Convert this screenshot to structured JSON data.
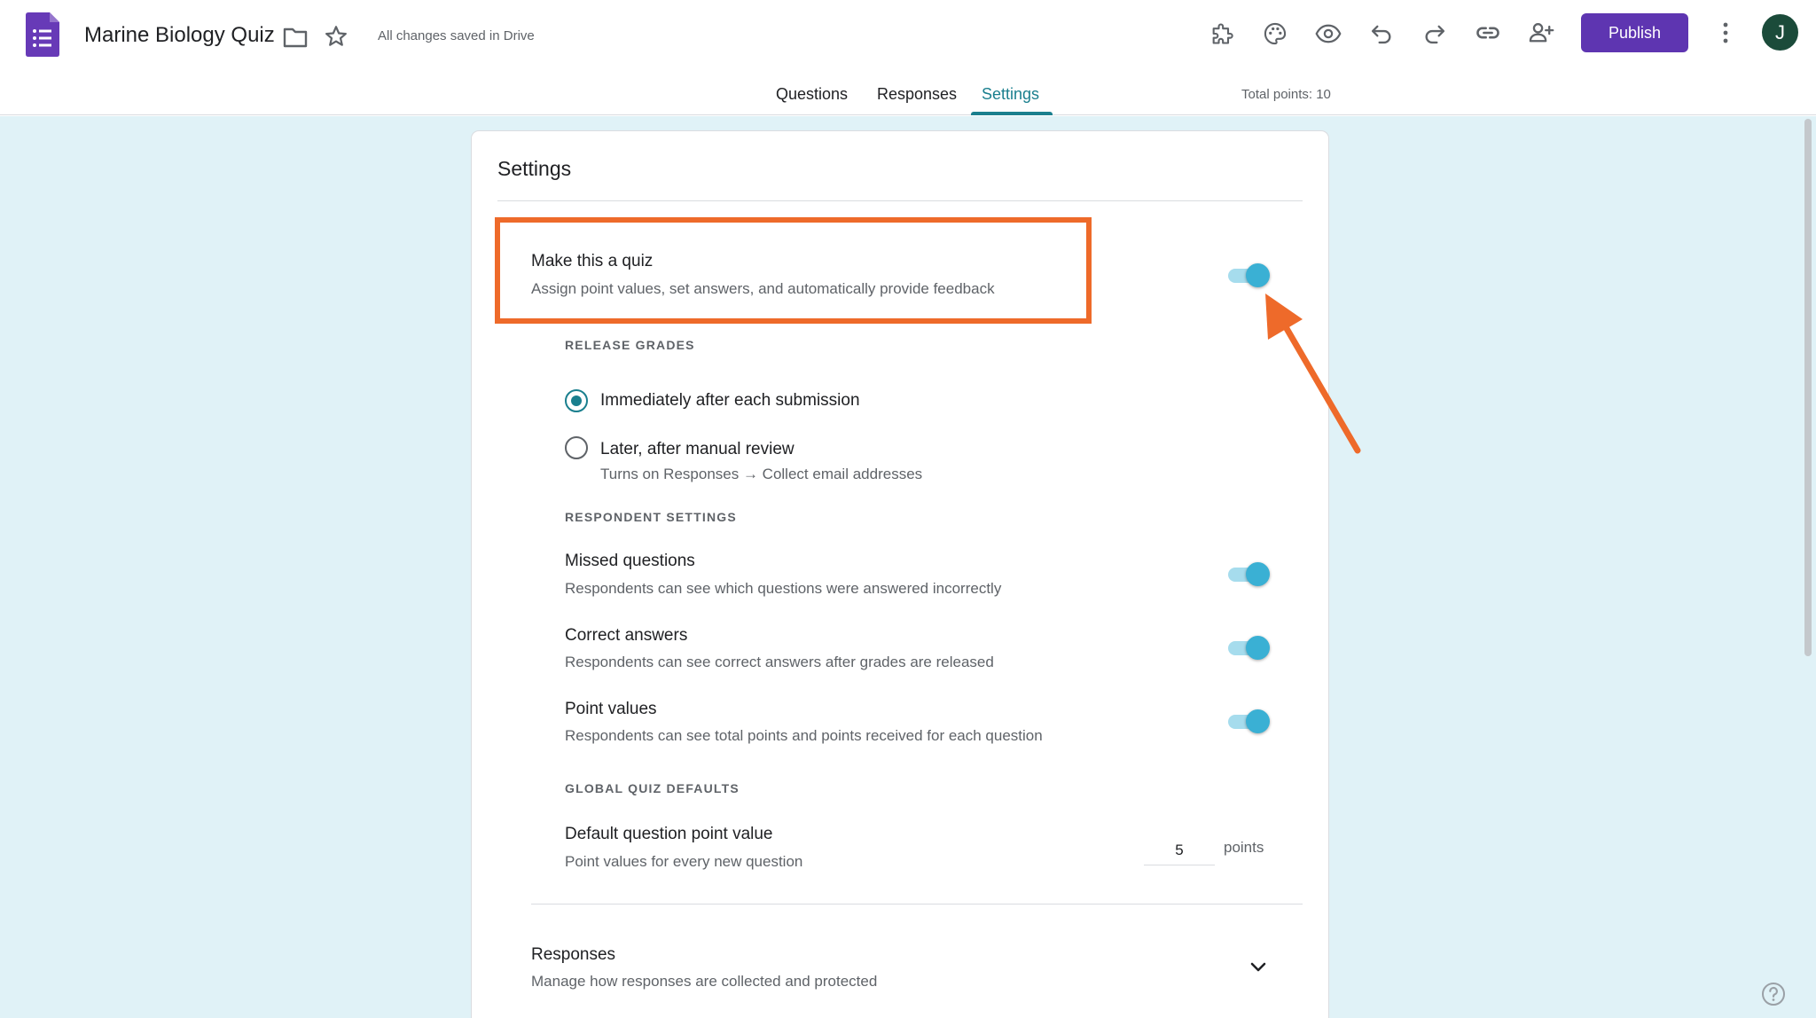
{
  "header": {
    "app_icon": "forms-list-icon",
    "doc_title": "Marine Biology Quiz",
    "save_status": "All changes saved in Drive",
    "publish_label": "Publish",
    "avatar_initial": "J",
    "brand_color": "#5e35b1"
  },
  "tabs": [
    {
      "label": "Questions"
    },
    {
      "label": "Responses"
    },
    {
      "label": "Settings",
      "active": true
    }
  ],
  "total_points": "Total points: 10",
  "settings": {
    "title": "Settings",
    "quiz": {
      "title": "Make this a quiz",
      "description": "Assign point values, set answers, and automatically provide feedback",
      "enabled": true
    },
    "release_grades": {
      "label": "RELEASE GRADES",
      "options": [
        {
          "label": "Immediately after each submission",
          "selected": true
        },
        {
          "label": "Later, after manual review",
          "note": "Turns on Responses → Collect email addresses",
          "selected": false
        }
      ]
    },
    "respondent_settings": {
      "label": "RESPONDENT SETTINGS",
      "items": [
        {
          "title": "Missed questions",
          "description": "Respondents can see which questions were answered incorrectly",
          "enabled": true
        },
        {
          "title": "Correct answers",
          "description": "Respondents can see correct answers after grades are released",
          "enabled": true
        },
        {
          "title": "Point values",
          "description": "Respondents can see total points and points received for each question",
          "enabled": true
        }
      ]
    },
    "global_defaults": {
      "label": "GLOBAL QUIZ DEFAULTS",
      "title": "Default question point value",
      "description": "Point values for every new question",
      "value": "5",
      "unit": "points"
    },
    "responses": {
      "title": "Responses",
      "description": "Manage how responses are collected and protected"
    }
  },
  "annotation_color": "#ee6a2a",
  "accent_color": "#1a7f8e"
}
